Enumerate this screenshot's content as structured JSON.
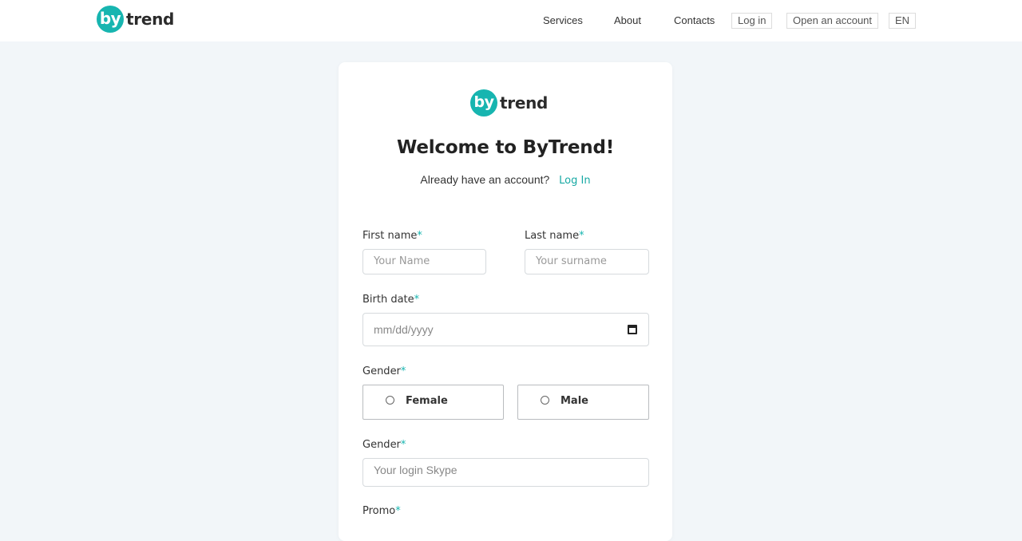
{
  "brand": {
    "by": "by",
    "word": "trend",
    "accent": "#17b5b0"
  },
  "nav": {
    "services": "Services",
    "about": "About",
    "contacts": "Contacts",
    "login": "Log in",
    "open_account": "Open an account",
    "lang": "EN"
  },
  "card": {
    "title": "Welcome to ByTrend!",
    "have_account": "Already have an account?",
    "login_link": "Log In"
  },
  "form": {
    "first_name": {
      "label": "First name",
      "required": "*",
      "placeholder": "Your Name"
    },
    "last_name": {
      "label": "Last name",
      "required": "*",
      "placeholder": "Your surname"
    },
    "birth_date": {
      "label": "Birth date",
      "required": "*",
      "placeholder": "mm/dd/yyyy",
      "icon": "calendar-icon"
    },
    "gender": {
      "label": "Gender",
      "required": "*",
      "options": [
        "Female",
        "Male"
      ]
    },
    "skype": {
      "label": "Gender",
      "required": "*",
      "placeholder": "Your login Skype"
    },
    "promo": {
      "label": "Promo",
      "required": "*"
    }
  }
}
